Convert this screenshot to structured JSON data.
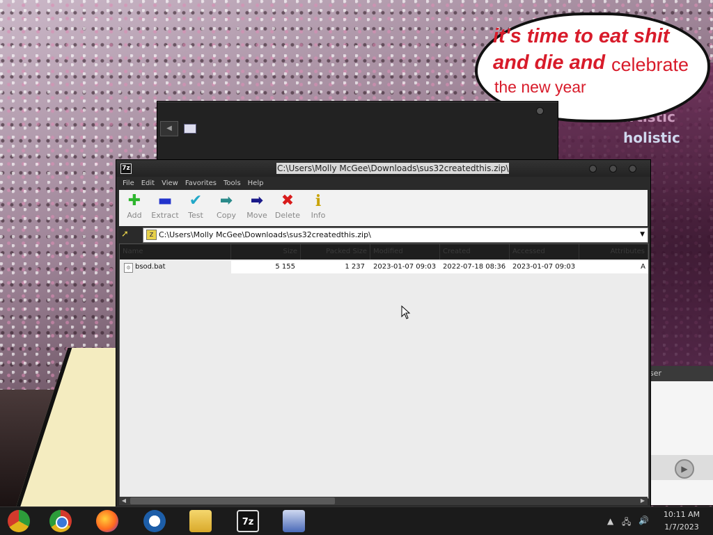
{
  "wallpaper": {
    "bubble": {
      "line1": "it's time to eat shit",
      "line2": "and die and",
      "line2b": "celebrate",
      "line3": "the new year"
    },
    "bg_text_1": "artistic",
    "bg_text_2": "holistic"
  },
  "side_window": {
    "strip_text": "ser"
  },
  "window": {
    "title": "C:\\Users\\Molly McGee\\Downloads\\sus32createdthis.zip\\",
    "icon_text": "7z",
    "menu": [
      "File",
      "Edit",
      "View",
      "Favorites",
      "Tools",
      "Help"
    ],
    "toolbar": {
      "add": "Add",
      "extract": "Extract",
      "test": "Test",
      "copy": "Copy",
      "move": "Move",
      "delete": "Delete",
      "info": "Info"
    },
    "address": "C:\\Users\\Molly McGee\\Downloads\\sus32createdthis.zip\\",
    "columns": {
      "name": "Name",
      "size": "Size",
      "packed": "Packed Size",
      "modified": "Modified",
      "created": "Created",
      "accessed": "Accessed",
      "attributes": "Attributes"
    },
    "files": [
      {
        "name": "bsod.bat",
        "size": "5 155",
        "packed": "1 237",
        "modified": "2023-01-07 09:03",
        "created": "2022-07-18 08:36",
        "accessed": "2023-01-07 09:03",
        "attributes": "A"
      }
    ]
  },
  "taskbar": {
    "apps": [
      "chrome-like-icon",
      "chrome-icon",
      "firefox-icon",
      "obama-logo-icon",
      "file-explorer-icon",
      "7zip-icon",
      "computer-icon"
    ],
    "zip_label": "7z",
    "time": "10:11 AM",
    "date": "1/7/2023"
  },
  "colors": {
    "bubble_text": "#d81b2a",
    "window_chrome": "#2a2a2a",
    "list_bg": "#ececec"
  }
}
